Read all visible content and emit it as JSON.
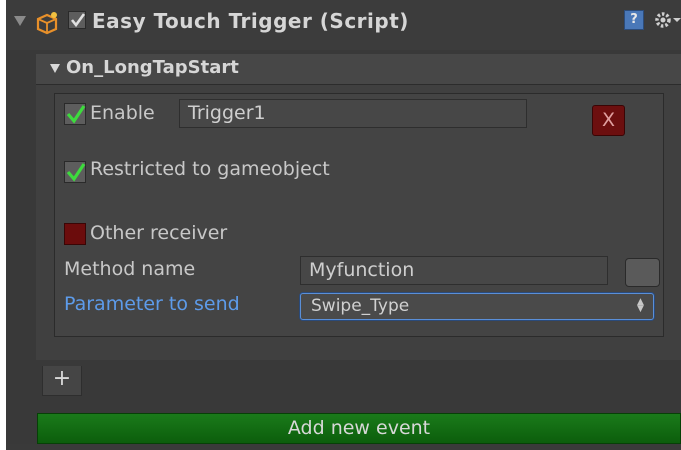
{
  "component": {
    "title": "Easy Touch Trigger (Script)",
    "enabled": true
  },
  "event": {
    "title": "On_LongTapStart",
    "enable_label": "Enable",
    "enable_checked": true,
    "trigger_name": "Trigger1",
    "delete_label": "X",
    "restricted_label": "Restricted to gameobject",
    "restricted_checked": true,
    "other_receiver_label": "Other receiver",
    "other_receiver_checked": false,
    "method_name_label": "Method name",
    "method_name_value": "Myfunction",
    "parameter_label": "Parameter to send",
    "parameter_value": "Swipe_Type"
  },
  "add_tab_label": "+",
  "add_event_label": "Add new event",
  "colors": {
    "panel": "#393939",
    "check_green": "#3ddb3d",
    "delete_red": "#6c0f0f",
    "accent_blue": "#5d9bea",
    "add_button_green": "#137013"
  },
  "icons": {
    "script": "script-gear-icon",
    "help": "help-icon",
    "settings": "gear-icon"
  }
}
